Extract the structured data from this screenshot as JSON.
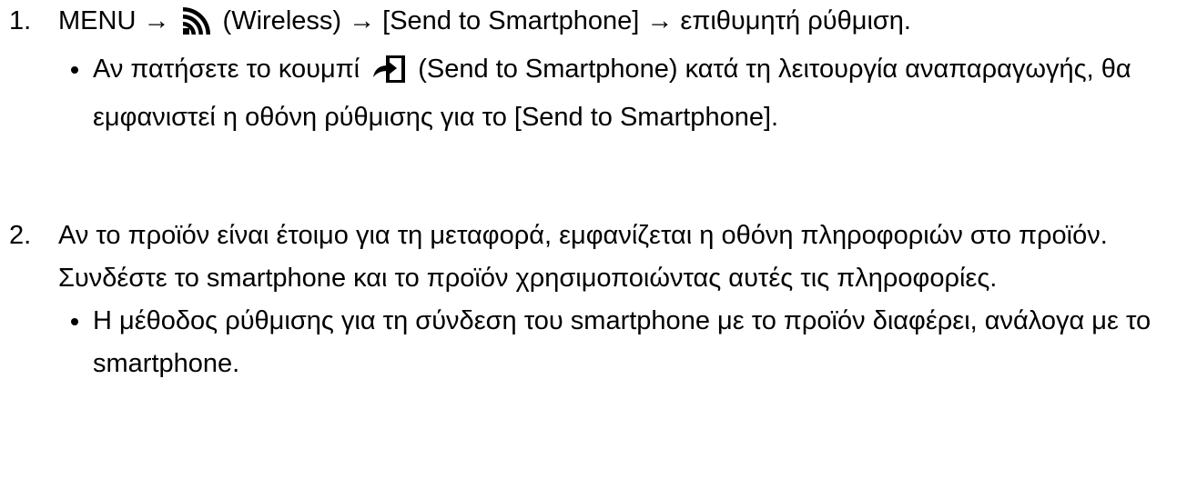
{
  "step1": {
    "number": "1.",
    "part1": "MENU → ",
    "wireless_icon": "wireless-icon",
    "part2": " (Wireless) → [Send to Smartphone] → επιθυμητή ρύθμιση.",
    "note_part1": "Αν πατήσετε το κουμπί ",
    "send_icon": "send-to-smartphone-icon",
    "note_part2": " (Send to Smartphone) κατά τη λειτουργία αναπαραγωγής, θα εμφανιστεί η οθόνη ρύθμισης για το [Send to Smartphone]."
  },
  "step2": {
    "number": "2.",
    "text": "Αν το προϊόν είναι έτοιμο για τη μεταφορά, εμφανίζεται η οθόνη πληροφοριών στο προϊόν. Συνδέστε το smartphone και το προϊόν χρησιμοποιώντας αυτές τις πληροφορίες.",
    "note": "Η μέθοδος ρύθμισης για τη σύνδεση του smartphone με το προϊόν διαφέρει, ανάλογα με το smartphone."
  }
}
